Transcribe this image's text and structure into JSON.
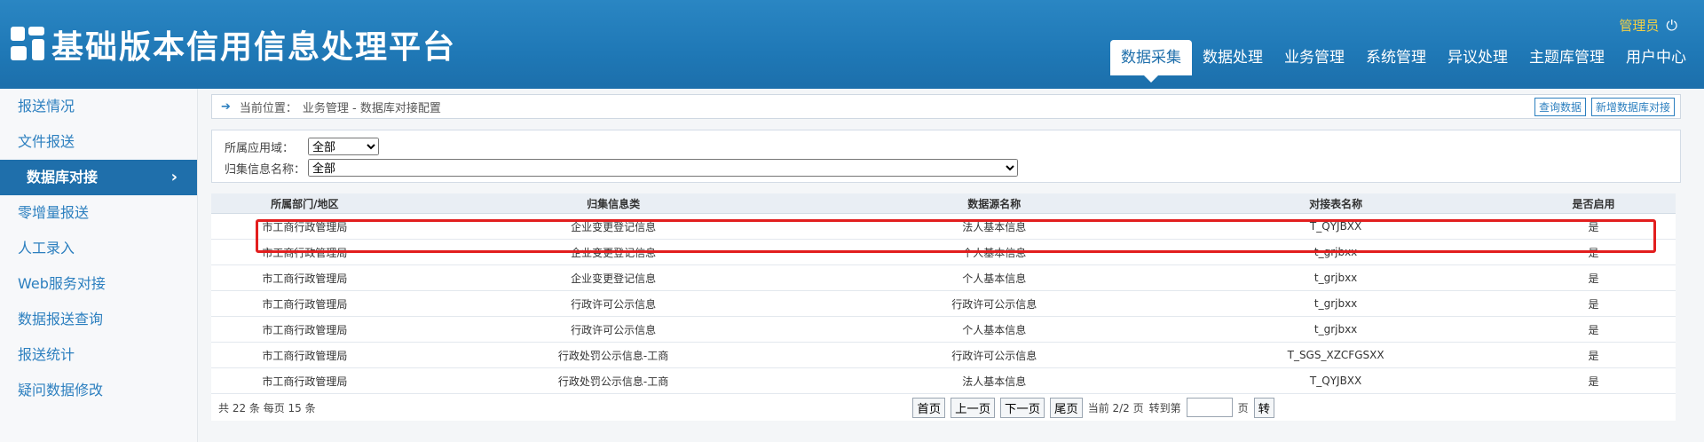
{
  "app": {
    "title": "基础版本信用信息处理平台",
    "admin_label": "管理员",
    "power_icon": "power-icon"
  },
  "nav": {
    "items": [
      {
        "label": "数据采集",
        "active": true
      },
      {
        "label": "数据处理",
        "active": false
      },
      {
        "label": "业务管理",
        "active": false
      },
      {
        "label": "系统管理",
        "active": false
      },
      {
        "label": "异议处理",
        "active": false
      },
      {
        "label": "主题库管理",
        "active": false
      },
      {
        "label": "用户中心",
        "active": false
      }
    ]
  },
  "sidebar": {
    "items": [
      {
        "label": "报送情况"
      },
      {
        "label": "文件报送"
      },
      {
        "label": "数据库对接",
        "active": true
      },
      {
        "label": "零增量报送"
      },
      {
        "label": "人工录入"
      },
      {
        "label": "Web服务对接"
      },
      {
        "label": "数据报送查询"
      },
      {
        "label": "报送统计"
      },
      {
        "label": "疑问数据修改"
      }
    ]
  },
  "breadcrumb": {
    "prefix": "当前位置：",
    "path": "业务管理 - 数据库对接配置",
    "buttons": [
      "查询数据",
      "新增数据库对接"
    ]
  },
  "filters": {
    "domain_label": "所属应用域：",
    "domain_value": "全部",
    "info_label": "归集信息名称：",
    "info_value": "全部"
  },
  "table": {
    "headers": [
      "所属部门/地区",
      "归集信息类",
      "数据源名称",
      "对接表名称",
      "是否启用"
    ],
    "rows": [
      [
        "市工商行政管理局",
        "企业变更登记信息",
        "法人基本信息",
        "T_QYJBXX",
        "是"
      ],
      [
        "市工商行政管理局",
        "企业变更登记信息",
        "个人基本信息",
        "t_grjbxx",
        "是"
      ],
      [
        "市工商行政管理局",
        "企业变更登记信息",
        "个人基本信息",
        "t_grjbxx",
        "是"
      ],
      [
        "市工商行政管理局",
        "行政许可公示信息",
        "行政许可公示信息",
        "t_grjbxx",
        "是"
      ],
      [
        "市工商行政管理局",
        "行政许可公示信息",
        "个人基本信息",
        "t_grjbxx",
        "是"
      ],
      [
        "市工商行政管理局",
        "行政处罚公示信息-工商",
        "行政许可公示信息",
        "T_SGS_XZCFGSXX",
        "是"
      ],
      [
        "市工商行政管理局",
        "行政处罚公示信息-工商",
        "法人基本信息",
        "T_QYJBXX",
        "是"
      ]
    ]
  },
  "pager": {
    "summary": "共 22 条  每页 15 条",
    "first": "首页",
    "prev": "上一页",
    "next": "下一页",
    "last": "尾页",
    "current": "当前 2/2 页",
    "goto_label": "转到第",
    "goto_unit": "页",
    "goto_btn": "转"
  },
  "colors": {
    "header_blue": "#1f78b6",
    "accent_blue": "#2c7fbf",
    "highlight_red": "#e21e1e",
    "admin_yellow": "#f2d045"
  }
}
